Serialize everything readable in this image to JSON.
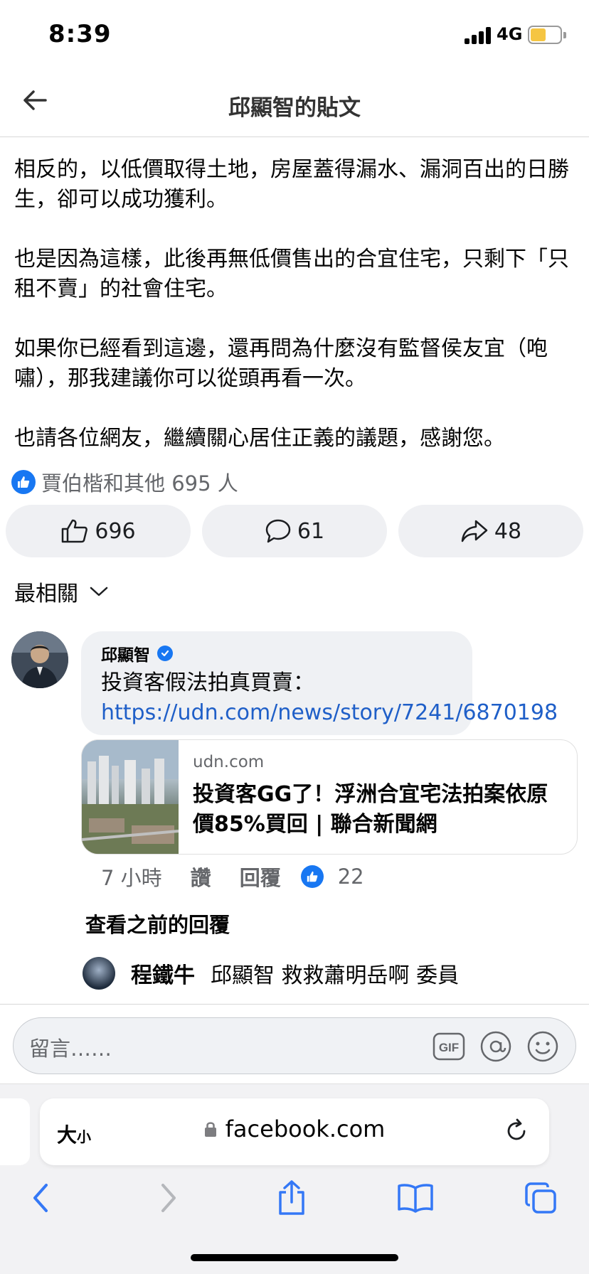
{
  "status": {
    "time": "8:39",
    "network": "4G",
    "battery_level": 0.55,
    "battery_color": "#f5c542"
  },
  "header": {
    "back_icon": "back-arrow-icon",
    "title": "邱顯智的貼文"
  },
  "post": {
    "paragraphs": [
      "相反的，以低價取得土地，房屋蓋得漏水、漏洞百出的日勝生，卻可以成功獲利。",
      "也是因為這樣，此後再無低價售出的合宜住宅，只剩下「只租不賣」的社會住宅。",
      "如果你已經看到這邊，還再問為什麼沒有監督侯友宜（咆嘯），那我建議你可以從頭再看一次。",
      "也請各位網友，繼續關心居住正義的議題，感謝您。"
    ],
    "reactions_text": "賈伯楷和其他 695 人",
    "like_count": "696",
    "comment_count": "61",
    "share_count": "48"
  },
  "sort": {
    "label": "最相關"
  },
  "comment": {
    "author": "邱顯智",
    "text_prefix": "投資客假法拍真買賣：",
    "link_text": "https://udn.com/news/story/7241/6870198",
    "card": {
      "domain": "udn.com",
      "title": "投資客GG了！浮洲合宜宅法拍案依原價85%買回 | 聯合新聞網"
    },
    "time": "7 小時",
    "like_label": "讚",
    "reply_label": "回覆",
    "reaction_count": "22"
  },
  "view_previous": "查看之前的回覆",
  "reply": {
    "author": "程鐵牛",
    "text": "邱顯智 救救蕭明岳啊 委員"
  },
  "input": {
    "placeholder": "留言……"
  },
  "safari": {
    "text_size_label": "大",
    "text_size_small": "小",
    "url": "facebook.com"
  },
  "colors": {
    "accent": "#1877f2",
    "link": "#1f5fc8",
    "button_bg": "#eff0f3"
  }
}
